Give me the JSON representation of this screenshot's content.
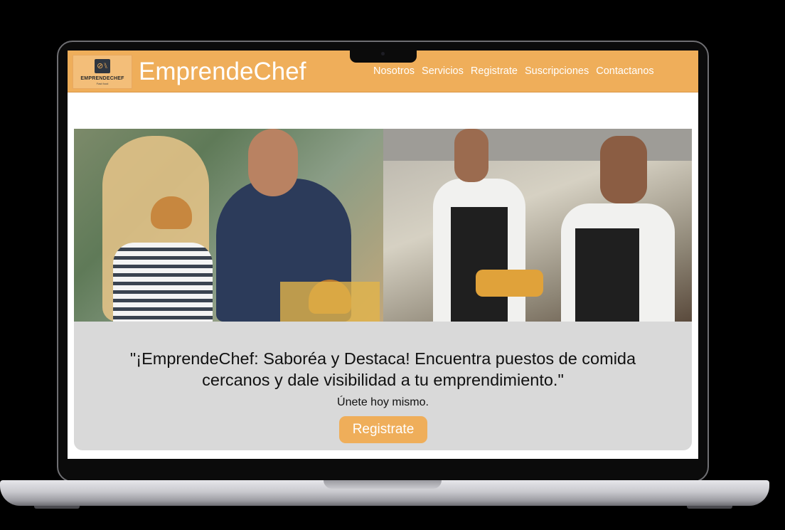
{
  "navbar": {
    "logo_text": "EMPRENDECHEF",
    "logo_sub": "Fast food",
    "brand": "EmprendeChef",
    "links": [
      "Nosotros",
      "Servicios",
      "Registrate",
      "Suscripciones",
      "Contactanos"
    ]
  },
  "hero": {
    "tagline": "\"¡EmprendeChef: Saboréa y Destaca! Encuentra puestos de comida cercanos y dale visibilidad a tu emprendimiento.\"",
    "subline": "Únete hoy mismo.",
    "cta_label": "Registrate"
  },
  "colors": {
    "accent": "#efae5a",
    "hero_bg": "#d9d9d9",
    "text": "#111111"
  },
  "icons": {
    "logo": "chef-utensils-icon"
  }
}
